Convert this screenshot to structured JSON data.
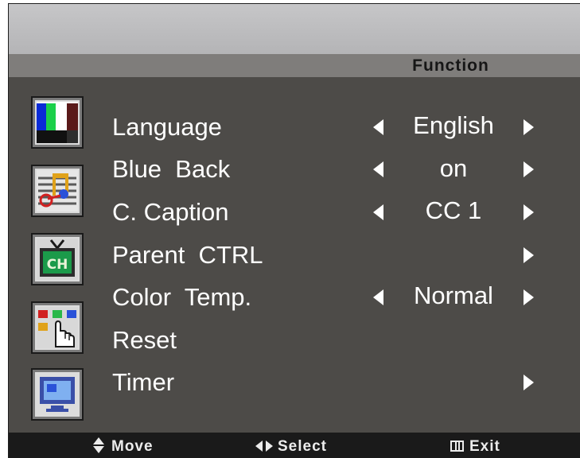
{
  "header": {
    "title": "Function"
  },
  "menu": {
    "items": [
      {
        "label": "Language",
        "value": "English",
        "left_arrow": true,
        "right_arrow": true
      },
      {
        "label": "Blue  Back",
        "value": "on",
        "left_arrow": true,
        "right_arrow": true
      },
      {
        "label": "C. Caption",
        "value": "CC 1",
        "left_arrow": true,
        "right_arrow": true
      },
      {
        "label": "Parent  CTRL",
        "value": "",
        "left_arrow": false,
        "right_arrow": true
      },
      {
        "label": "Color  Temp.",
        "value": "Normal",
        "left_arrow": true,
        "right_arrow": true
      },
      {
        "label": "Reset",
        "value": "",
        "left_arrow": false,
        "right_arrow": false
      },
      {
        "label": "Timer",
        "value": "",
        "left_arrow": false,
        "right_arrow": true
      }
    ]
  },
  "side_icons": [
    "picture-color-bars-icon",
    "audio-music-icon",
    "tv-channel-icon",
    "function-hand-icon",
    "timer-monitor-icon"
  ],
  "footer": {
    "move": "Move",
    "select": "Select",
    "exit": "Exit"
  },
  "colors": {
    "panel": "#4d4b48",
    "title_strip": "#7f7d7b",
    "top_bar": "#c0c0c2",
    "footer": "#1a1a1a",
    "text": "#ffffff"
  }
}
